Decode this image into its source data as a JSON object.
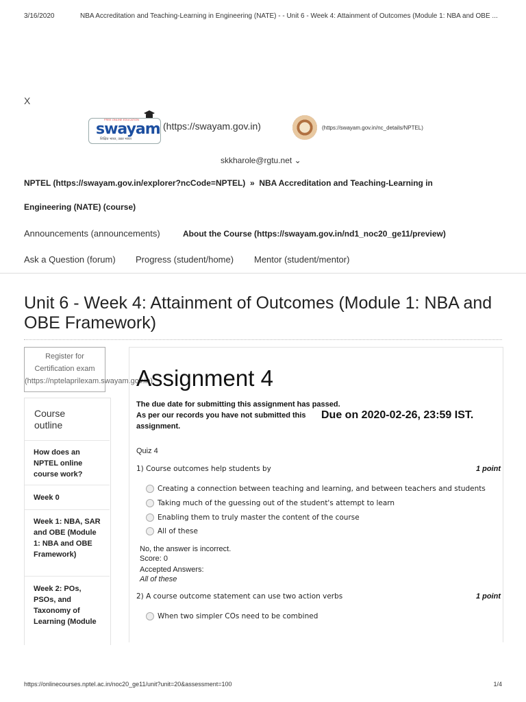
{
  "print_header": {
    "date": "3/16/2020",
    "page_title": "NBA Accreditation and Teaching-Learning in Engineering (NATE) - - Unit 6 - Week 4: Attainment of Outcomes (Module 1: NBA and OBE ..."
  },
  "close_label": "X",
  "logos": {
    "swayam_text": "swayam",
    "swayam_top": "FREE ONLINE EDUCATION",
    "swayam_tag": "शिक्षित भारत, उन्नत भारत",
    "swayam_link": "(https://swayam.gov.in)",
    "nptel_link": "(https://swayam.gov.in/nc_details/NPTEL)"
  },
  "user": {
    "email": "skkharole@rgtu.net",
    "caret": "⌄"
  },
  "breadcrumb": {
    "root": "NPTEL (https://swayam.gov.in/explorer?ncCode=NPTEL)",
    "separator": "»",
    "course_line1": "NBA Accreditation and Teaching-Learning in",
    "course_line2": "Engineering (NATE) (course)"
  },
  "nav": {
    "announcements": "Announcements (announcements)",
    "about": "About the Course (https://swayam.gov.in/nd1_noc20_ge11/preview)",
    "ask": "Ask a Question (forum)",
    "progress": "Progress (student/home)",
    "mentor": "Mentor (student/mentor)"
  },
  "unit_title": "Unit 6 - Week 4: Attainment of Outcomes (Module 1: NBA and OBE Framework)",
  "register": {
    "line1": "Register for",
    "line2": "Certification exam",
    "line3": "(https://nptelaprilexam.swayam.gov.in)"
  },
  "outline": {
    "heading": "Course outline",
    "items": [
      "How does an NPTEL online course work?",
      "Week 0",
      "Week 1: NBA, SAR and OBE (Module 1: NBA and OBE Framework)",
      "Week 2: POs, PSOs, and Taxonomy of Learning (Module"
    ]
  },
  "assignment": {
    "title": "Assignment 4",
    "due_passed": "The due date for submitting this assignment has passed.",
    "not_submitted_1": "As per our records you have not submitted this",
    "not_submitted_2": "assignment.",
    "due_on": "Due on 2020-02-26, 23:59 IST.",
    "quiz_label": "Quiz 4"
  },
  "questions": [
    {
      "text": "1) Course outcomes help students by",
      "points": "1 point",
      "options": [
        "Creating a connection between teaching and learning, and between teachers and students",
        "Taking much of the guessing out of the student's attempt to learn",
        "Enabling them to truly master the content of the course",
        "All of these"
      ],
      "feedback": "No, the answer is incorrect.",
      "score": "Score: 0",
      "accepted_label": "Accepted Answers:",
      "accepted": "All of these"
    },
    {
      "text": "2) A course outcome statement can use two action verbs",
      "points": "1 point",
      "options": [
        "When two simpler COs need to be combined"
      ]
    }
  ],
  "footer": {
    "url": "https://onlinecourses.nptel.ac.in/noc20_ge11/unit?unit=20&assessment=100",
    "page": "1/4"
  }
}
